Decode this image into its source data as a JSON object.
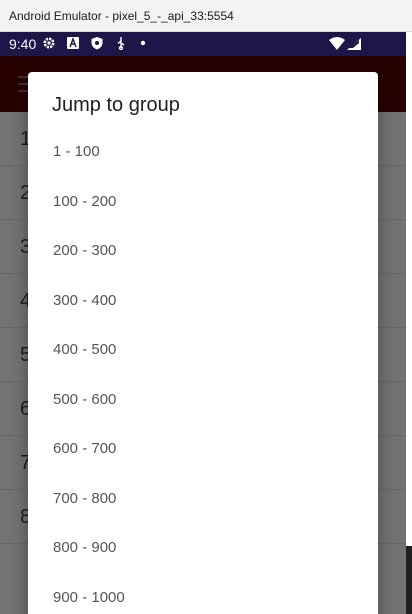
{
  "window": {
    "title": "Android Emulator - pixel_5_-_api_33:5554"
  },
  "status_bar": {
    "time": "9:40",
    "left_icons": [
      "gear-icon",
      "font-a-icon",
      "shield-icon",
      "usb-icon",
      "dot-icon"
    ],
    "right_icons": [
      "wifi-icon",
      "signal-icon"
    ]
  },
  "background_list": {
    "rows": [
      "1",
      "2",
      "3",
      "4",
      "5",
      "6",
      "7",
      "8"
    ]
  },
  "dialog": {
    "title": "Jump to group",
    "options": [
      "1 - 100",
      "100 - 200",
      "200 - 300",
      "300 - 400",
      "400 - 500",
      "500 - 600",
      "600 - 700",
      "700 - 800",
      "800 - 900",
      "900 - 1000"
    ]
  },
  "colors": {
    "status_bar": "#1e1548",
    "app_bar": "#5a0000"
  }
}
